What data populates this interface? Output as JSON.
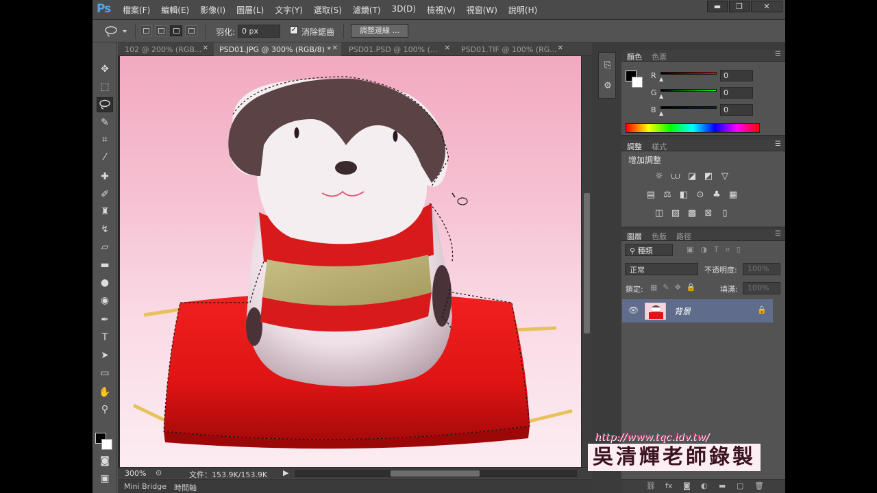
{
  "app": {
    "logo": "Ps"
  },
  "menu": [
    "檔案(F)",
    "編輯(E)",
    "影像(I)",
    "圖層(L)",
    "文字(Y)",
    "選取(S)",
    "濾鏡(T)",
    "3D(D)",
    "檢視(V)",
    "視窗(W)",
    "說明(H)"
  ],
  "window_controls": {
    "minimize": "▬",
    "restore": "❐",
    "close": "✕"
  },
  "options": {
    "feather_label": "羽化:",
    "feather_value": "0 px",
    "antialias_label": "消除鋸齒",
    "antialias_checked": true,
    "refine_edge_label": "調整邊緣 ..."
  },
  "tabs": [
    {
      "label": "102 @ 200% (RGB...",
      "active": false
    },
    {
      "label": "PSD01.JPG @ 300% (RGB/8) *",
      "active": true
    },
    {
      "label": "PSD01.PSD @ 100% (...",
      "active": false
    },
    {
      "label": "PSD01.TIF @ 100% (RG...",
      "active": false
    }
  ],
  "status": {
    "zoom": "300%",
    "doc": "文件：153.9K/153.9K"
  },
  "bottom_tabs": [
    "Mini Bridge",
    "時間軸"
  ],
  "color_panel": {
    "tabs": [
      "顏色",
      "色票"
    ],
    "channels": [
      {
        "label": "R",
        "value": "0",
        "color": "#e01010"
      },
      {
        "label": "G",
        "value": "0",
        "color": "#10c020"
      },
      {
        "label": "B",
        "value": "0",
        "color": "#1020e0"
      }
    ]
  },
  "adjust_panel": {
    "tabs": [
      "調整",
      "樣式"
    ],
    "title": "增加調整"
  },
  "layers_panel": {
    "tabs": [
      "圖層",
      "色版",
      "路徑"
    ],
    "filter": "種類",
    "blend_mode": "正常",
    "opacity_label": "不透明度:",
    "opacity_value": "100%",
    "lock_label": "鎖定:",
    "fill_label": "填滿:",
    "fill_value": "100%",
    "layer_name": "背景"
  },
  "watermark": {
    "url": "http://www.tqc.idv.tw/",
    "author": "吳清輝老師錄製"
  }
}
